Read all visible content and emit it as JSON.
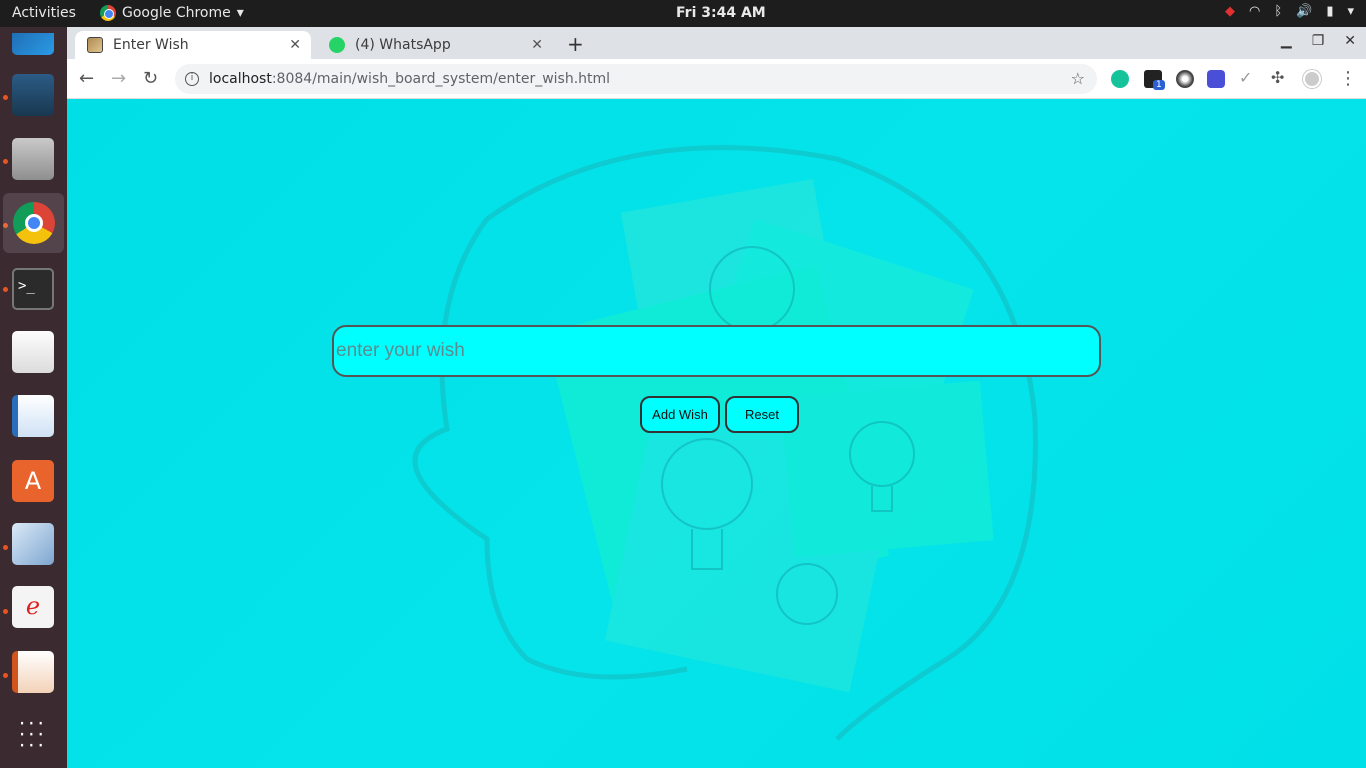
{
  "topbar": {
    "activities": "Activities",
    "app_name": "Google Chrome",
    "clock": "Fri  3:44 AM"
  },
  "dock": {
    "items": [
      "mysql-workbench",
      "file-manager",
      "google-chrome",
      "terminal",
      "text-editor",
      "libreoffice-writer",
      "software-center",
      "virtualbox",
      "document-viewer",
      "libreoffice-impress",
      "show-applications"
    ]
  },
  "browser": {
    "tabs": [
      {
        "title": "Enter Wish",
        "active": true
      },
      {
        "title": "(4) WhatsApp",
        "active": false
      }
    ],
    "url_host": "localhost",
    "url_rest": ":8084/main/wish_board_system/enter_wish.html",
    "extensions_badge": "1"
  },
  "page": {
    "wish_placeholder": "enter your wish",
    "add_button": "Add Wish",
    "reset_button": "Reset"
  },
  "colors": {
    "page_bg": "#00e0e8",
    "input_bg": "#00ffff",
    "dock_bg": "#3b2b31",
    "topbar_bg": "#1d1d1d"
  }
}
